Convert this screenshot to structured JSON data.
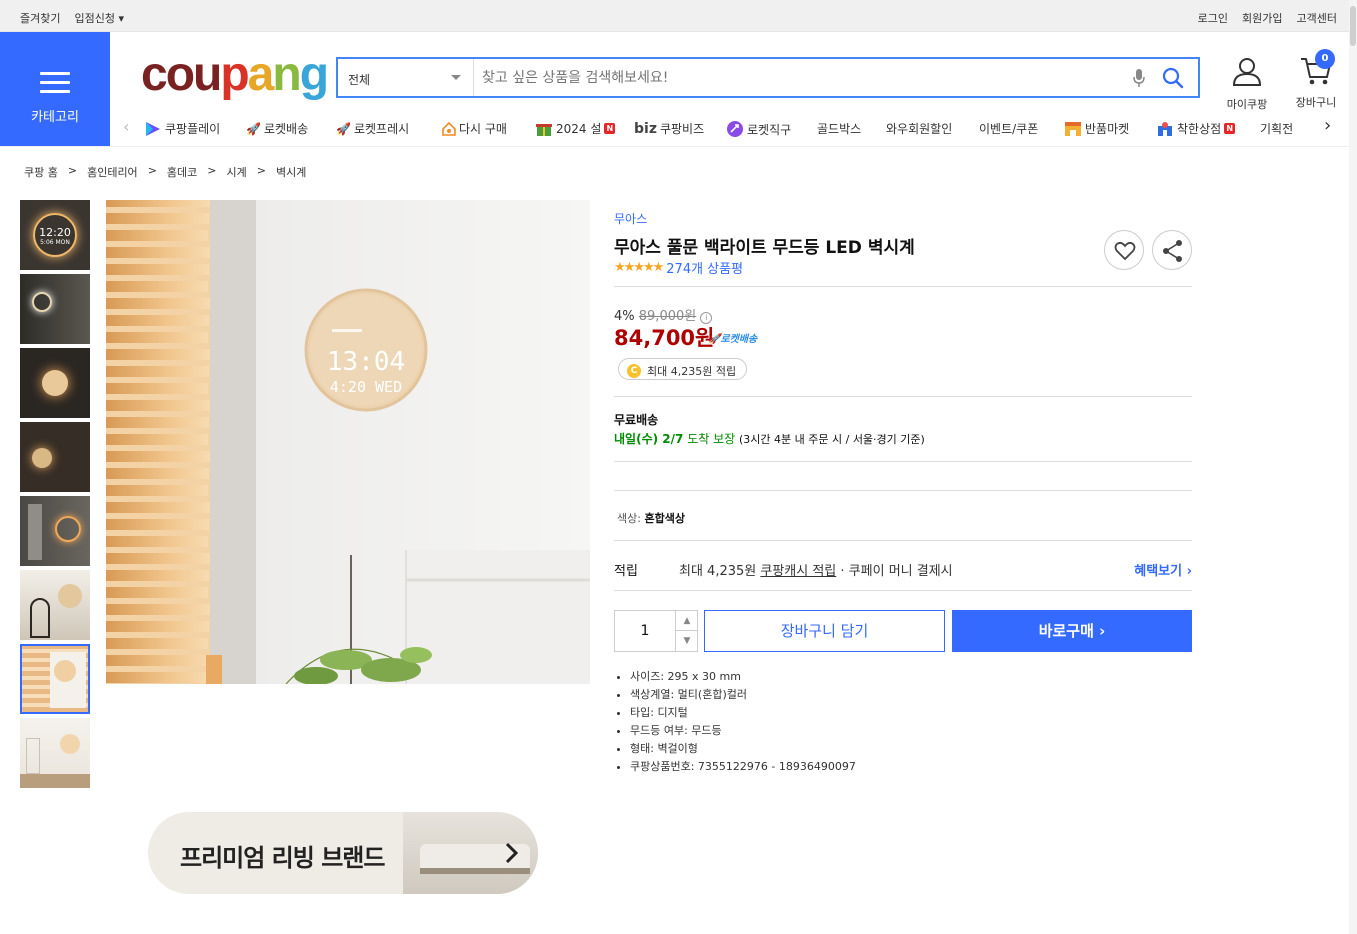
{
  "topbar": {
    "left": [
      "즐겨찾기",
      "입점신청 ▾"
    ],
    "right": [
      "로그인",
      "회원가입",
      "고객센터"
    ]
  },
  "category_label": "카테고리",
  "logo": {
    "c1": "cou",
    "c2": "p",
    "c3": "a",
    "c4": "n",
    "c5": "g"
  },
  "search": {
    "category": "전체",
    "placeholder": "찾고 싶은 상품을 검색해보세요!"
  },
  "header_icons": {
    "my_coupang": "마이쿠팡",
    "cart": "장바구니",
    "cart_count": "0"
  },
  "nav": {
    "items": [
      "쿠팡플레이",
      "로켓배송",
      "로켓프레시",
      "다시 구매",
      "2024 설",
      "쿠팡비즈",
      "로켓직구",
      "골드박스",
      "와우회원할인",
      "이벤트/쿠폰",
      "반품마켓",
      "착한상점",
      "기획전"
    ],
    "biz": "biz",
    "new_badge": "N"
  },
  "breadcrumb": [
    "쿠팡 홈",
    ">",
    "홈인테리어",
    ">",
    "홈데코",
    ">",
    "시계",
    ">",
    "벽시계"
  ],
  "clock_faces": {
    "main_time": "13:04",
    "main_date": "4:20 WED",
    "thumb1_time": "12:20",
    "thumb1_date": "5:06 MON"
  },
  "banner": {
    "text": "프리미엄 리빙 브랜드"
  },
  "product": {
    "brand": "무아스",
    "title": "무아스 풀문 백라이트 무드등 LED 벽시계",
    "stars": "★★★★★",
    "review_count": "274개 상품평",
    "discount_rate": "4%",
    "original_price": "89,000원",
    "price": "84,700원",
    "rocket_label": "로켓배송",
    "cash_badge": "최대 4,235원 적립",
    "shipping_label": "무료배송",
    "delivery_date": "내일(수) 2/7",
    "delivery_suffix": "도착 보장",
    "delivery_note": "(3시간 4분  내 주문 시 / 서울·경기 기준)",
    "option_label": "색상:",
    "option_value": "혼합색상",
    "accum_label": "적립",
    "accum_pre": "최대 4,235원",
    "accum_link": "쿠팡캐시 적립",
    "accum_post": "· 쿠페이 머니 결제시",
    "benefit_link": "혜택보기",
    "quantity": "1",
    "add_to_cart": "장바구니 담기",
    "buy_now": "바로구매",
    "specs": [
      "사이즈: 295 x 30 mm",
      "색상계열: 멀티(혼합)컬러",
      "타입: 디지털",
      "무드등 여부: 무드등",
      "형태: 벽걸이형",
      "쿠팡상품번호: 7355122976 - 18936490097"
    ]
  },
  "colors": {
    "accent": "#346aff",
    "price": "#ae0000",
    "delivery": "#008c00"
  }
}
